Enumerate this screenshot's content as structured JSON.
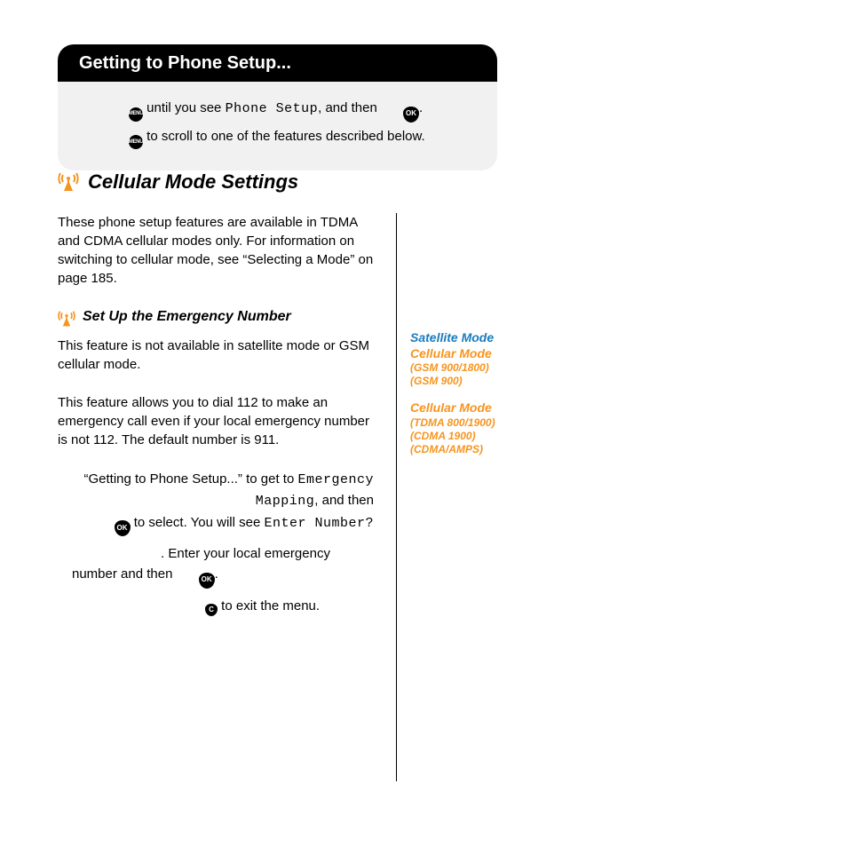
{
  "header": {
    "title": "Getting to Phone Setup..."
  },
  "graybox": {
    "row1a": "until you see",
    "row1b_lcd": "Phone Setup",
    "row1c": ", and then",
    "row1d": ".",
    "row2": "to scroll to one of the features described below.",
    "menu_label": "MENU",
    "ok_label": "OK"
  },
  "section": {
    "title": "Cellular Mode Settings"
  },
  "left": {
    "intro": "These phone setup features are available in TDMA and CDMA cellular modes only. For information on switching to cellular mode, see “Selecting a Mode” on page 185.",
    "subhead": "Set Up the Emergency Number",
    "p1": "This feature is not available in satellite mode or GSM cellular mode.",
    "p2": "This feature allows you to dial 112 to make an emergency call even if your local emergency number is not 112. The default number is 911.",
    "step1a": "“Getting to Phone Setup...” to get to",
    "step1b_lcd": "Emergency Mapping",
    "step1c": ", and then",
    "step1d": "to select. You will see",
    "step1e_lcd": "Enter Number?",
    "step2a": ". Enter your local emergency number and then",
    "step2b": ".",
    "step3": "to exit the menu.",
    "ok_label": "OK",
    "c_label": "C"
  },
  "right": {
    "satmode": "Satellite Mode",
    "cellmode1": "Cellular Mode",
    "gsm1": "(GSM 900/1800)",
    "gsm2": "(GSM 900)",
    "cellmode2": "Cellular Mode",
    "tdma": "(TDMA 800/1900)",
    "cdma1": "(CDMA 1900)",
    "cdma2": "(CDMA/AMPS)"
  }
}
